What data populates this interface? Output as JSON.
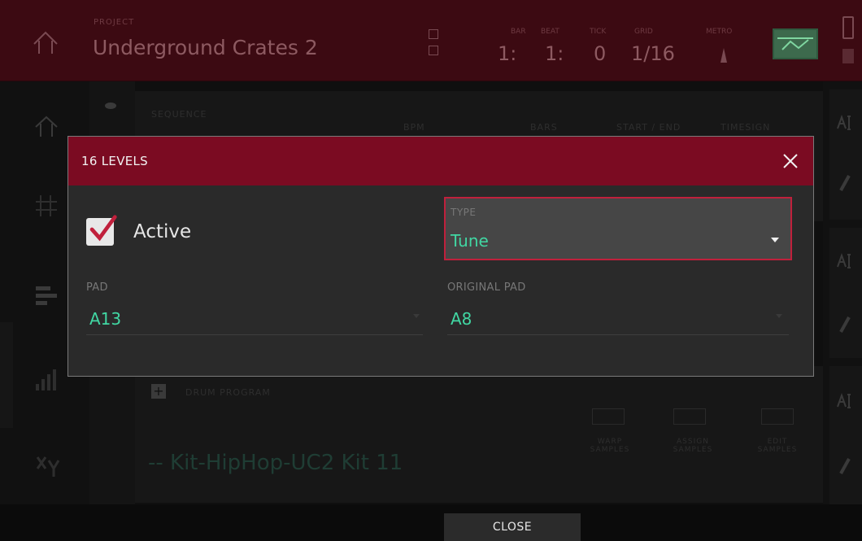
{
  "header": {
    "project_label": "PROJECT",
    "project_name": "Underground Crates 2",
    "position": {
      "bar_label": "BAR",
      "beat_label": "BEAT",
      "tick_label": "TICK",
      "grid_label": "GRID",
      "bar": "1:",
      "beat": "1:",
      "tick": "0",
      "grid": "1/16"
    },
    "tempo_label": "METRO"
  },
  "background": {
    "sequence_label": "SEQUENCE",
    "columns": [
      "BPM",
      "BARS",
      "START / END",
      "TIMESIGN"
    ],
    "drum_program_label": "DRUM PROGRAM",
    "program_name": "Kit-HipHop-UC2 Kit 11",
    "actions": [
      {
        "label": "WARP SAMPLES"
      },
      {
        "label": "ASSIGN SAMPLES"
      },
      {
        "label": "EDIT SAMPLES"
      }
    ]
  },
  "modal": {
    "title": "16 LEVELS",
    "active_label": "Active",
    "active_checked": true,
    "type": {
      "label": "TYPE",
      "value": "Tune"
    },
    "pad": {
      "label": "PAD",
      "value": "A13"
    },
    "original_pad": {
      "label": "ORIGINAL PAD",
      "value": "A8"
    }
  },
  "footer": {
    "close_label": "CLOSE"
  },
  "colors": {
    "accent": "#7b0b22",
    "value_green": "#41d7a3",
    "select_border": "#c0203c",
    "check_mark": "#c0203c"
  }
}
